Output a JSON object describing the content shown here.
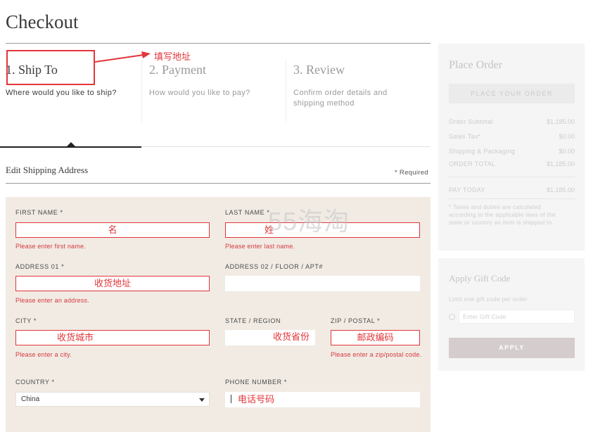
{
  "page": {
    "title": "Checkout"
  },
  "steps": [
    {
      "number_title": "1. Ship To",
      "desc": "Where would you like to ship?"
    },
    {
      "number_title": "2. Payment",
      "desc": "How would you like to pay?"
    },
    {
      "number_title": "3. Review",
      "desc": "Confirm order details and shipping method"
    }
  ],
  "annotation": {
    "label": "填写地址"
  },
  "section": {
    "title": "Edit Shipping Address",
    "required_note": "* Required"
  },
  "form": {
    "first_name": {
      "label": "FIRST NAME *",
      "value": "名",
      "error": "Please enter first name."
    },
    "last_name": {
      "label": "LAST NAME *",
      "value": "姓",
      "error": "Please enter last name."
    },
    "address1": {
      "label": "ADDRESS 01 *",
      "value": "收货地址",
      "error": "Please enter an address."
    },
    "address2": {
      "label": "ADDRESS 02 / FLOOR / APT#",
      "value": ""
    },
    "city": {
      "label": "CITY *",
      "value": "收货城市",
      "error": "Please enter a city."
    },
    "state": {
      "label": "STATE / REGION",
      "value": "收货省份"
    },
    "zip": {
      "label": "ZIP / POSTAL *",
      "value": "邮政编码",
      "error": "Please enter a zip/postal code."
    },
    "country": {
      "label": "COUNTRY *",
      "value": "China"
    },
    "phone": {
      "label": "PHONE NUMBER *",
      "value": "电话号码"
    }
  },
  "watermark": "55海淘",
  "order_summary": {
    "title": "Place Order",
    "place_button": "PLACE YOUR ORDER",
    "rows": [
      {
        "label": "Order Subtotal",
        "value": "$1,185.00"
      },
      {
        "label": "Sales Tax*",
        "value": "$0.00"
      },
      {
        "label": "Shipping & Packaging",
        "value": "$0.00"
      },
      {
        "label": "ORDER TOTAL",
        "value": "$1,185.00"
      }
    ],
    "pay_today": {
      "label": "PAY TODAY",
      "value": "$1,185.00"
    },
    "tax_note": "* Taxes and duties are calculated according to the applicable laws of the state or country an item is shipped to."
  },
  "gift": {
    "title": "Apply Gift Code",
    "note": "Limit one gift code per order",
    "placeholder": "Enter Gift Code",
    "apply_button": "APPLY"
  },
  "colors": {
    "error": "#e2363a",
    "form_bg": "#f1ebe4",
    "sidebar_bg": "#f5f5f5",
    "apply_bg": "#d4cccd"
  }
}
